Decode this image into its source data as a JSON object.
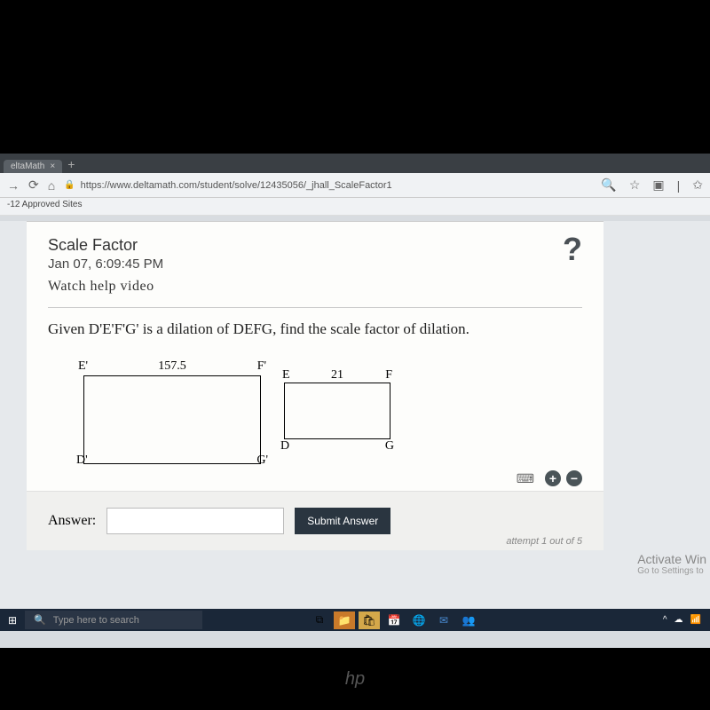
{
  "browser": {
    "tab_title": "eltaMath",
    "url": "https://www.deltamath.com/student/solve/12435056/_jhall_ScaleFactor1",
    "bookmark": "-12 Approved Sites"
  },
  "problem": {
    "title": "Scale Factor",
    "timestamp": "Jan 07, 6:09:45 PM",
    "watch_link": "Watch help video",
    "question": "Given D'E'F'G' is a dilation of DEFG, find the scale factor of dilation.",
    "help_symbol": "?"
  },
  "chart_data": {
    "type": "diagram",
    "shapes": [
      {
        "name": "D'E'F'G'",
        "type": "rectangle",
        "vertices": {
          "top_left": "E'",
          "top_right": "F'",
          "bottom_left": "D'",
          "bottom_right": "G'"
        },
        "top_side_length": 157.5
      },
      {
        "name": "DEFG",
        "type": "rectangle",
        "vertices": {
          "top_left": "E",
          "top_right": "F",
          "bottom_left": "D",
          "bottom_right": "G"
        },
        "top_side_length": 21
      }
    ]
  },
  "shapes": {
    "large": {
      "tl": "E'",
      "tr": "F'",
      "bl": "D'",
      "br": "G'",
      "top": "157.5"
    },
    "small": {
      "tl": "E",
      "tr": "F",
      "bl": "D",
      "br": "G",
      "top": "21"
    }
  },
  "answer": {
    "label": "Answer:",
    "submit": "Submit Answer",
    "attempt": "attempt 1 out of 5"
  },
  "windows": {
    "activate_title": "Activate Win",
    "activate_sub": "Go to Settings to"
  },
  "taskbar": {
    "search_placeholder": "Type here to search"
  },
  "hp": "hp"
}
